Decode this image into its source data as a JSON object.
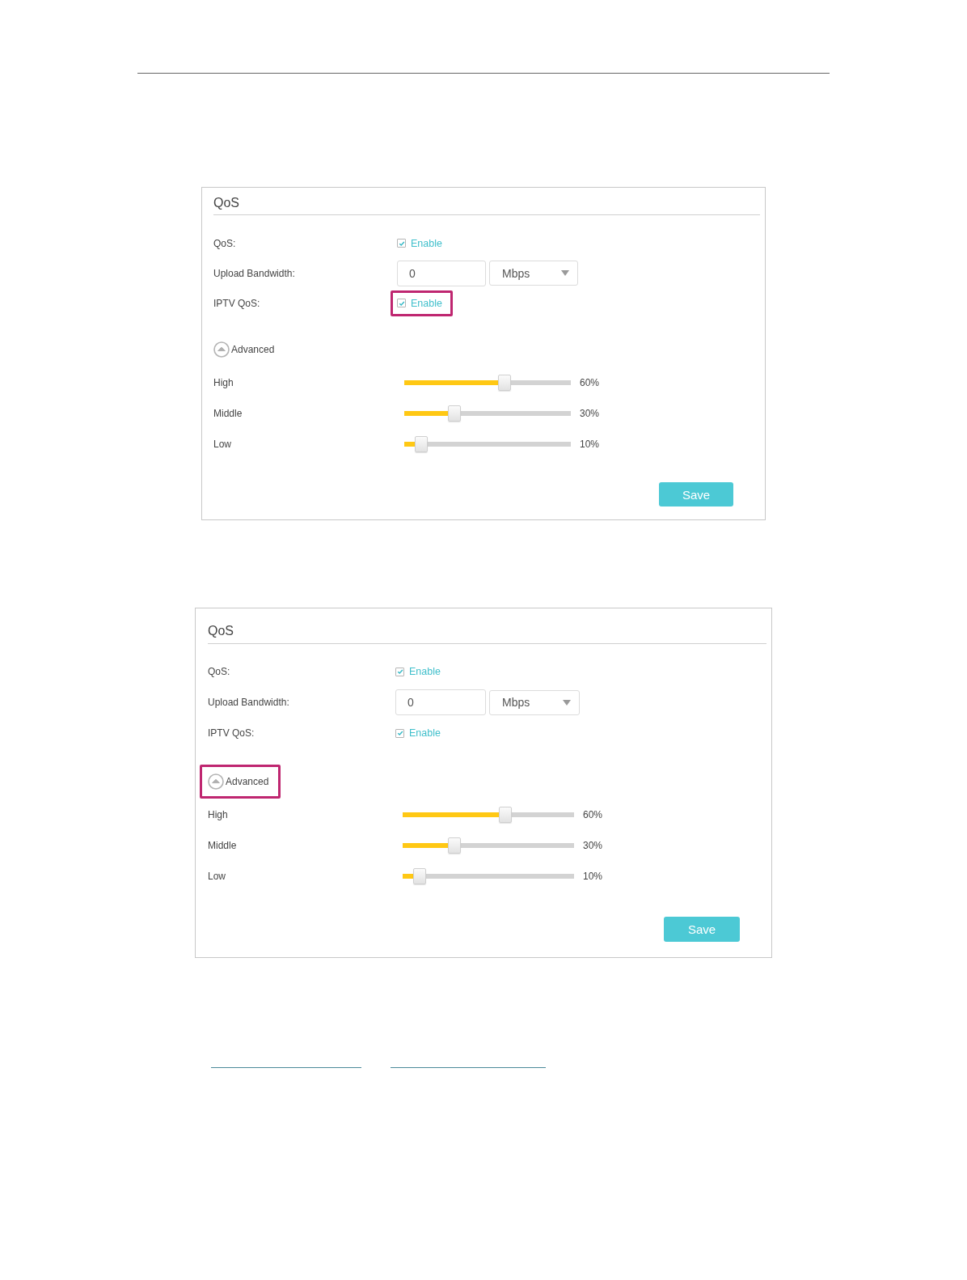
{
  "panels": [
    {
      "title": "QoS",
      "rows": [
        {
          "kind": "checkbox",
          "label": "QoS:",
          "checked": true,
          "option": "Enable",
          "highlighted": false
        },
        {
          "kind": "bandwidth",
          "label": "Upload Bandwidth:",
          "value": "0",
          "unit": "Mbps",
          "highlighted": false
        },
        {
          "kind": "checkbox",
          "label": "IPTV QoS:",
          "checked": true,
          "option": "Enable",
          "highlighted": true
        }
      ],
      "advanced": {
        "label": "Advanced",
        "expanded": true,
        "highlighted": false
      },
      "priorities": [
        {
          "label": "High",
          "level": 0.6,
          "reading": "60%"
        },
        {
          "label": "Middle",
          "level": 0.3,
          "reading": "30%"
        },
        {
          "label": "Low",
          "level": 0.1,
          "reading": "10%"
        }
      ],
      "save_button": "Save"
    },
    {
      "title": "QoS",
      "rows": [
        {
          "kind": "checkbox",
          "label": "QoS:",
          "checked": true,
          "option": "Enable",
          "highlighted": false
        },
        {
          "kind": "bandwidth",
          "label": "Upload Bandwidth:",
          "value": "0",
          "unit": "Mbps",
          "highlighted": false
        },
        {
          "kind": "checkbox",
          "label": "IPTV QoS:",
          "checked": true,
          "option": "Enable",
          "highlighted": false
        }
      ],
      "advanced": {
        "label": "Advanced",
        "expanded": true,
        "highlighted": true
      },
      "priorities": [
        {
          "label": "High",
          "level": 0.6,
          "reading": "60%"
        },
        {
          "label": "Middle",
          "level": 0.3,
          "reading": "30%"
        },
        {
          "label": "Low",
          "level": 0.1,
          "reading": "10%"
        }
      ],
      "save_button": "Save"
    }
  ]
}
